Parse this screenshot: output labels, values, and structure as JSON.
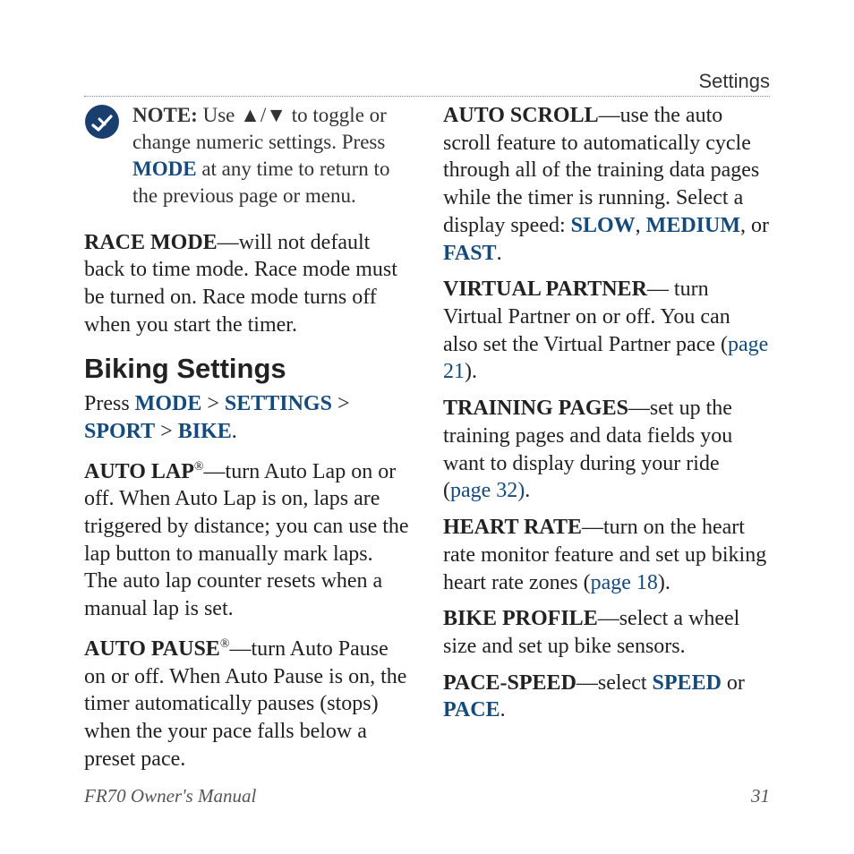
{
  "header": {
    "section_label": "Settings"
  },
  "note": {
    "prefix": "NOTE:",
    "part1": " Use ▲/▼ to toggle or change numeric settings. Press ",
    "mode": "MODE",
    "part2": " at any time to return to the previous page or menu."
  },
  "race_mode": {
    "label": "RACE MODE",
    "text": "—will not default back to time mode. Race mode must be turned on. Race mode turns off when you start the timer."
  },
  "biking": {
    "title": "Biking Settings",
    "press": "Press ",
    "mode": "MODE",
    "sep1": " > ",
    "settings": "SETTINGS",
    "sep2": " > ",
    "sport": "SPORT",
    "sep3": " > ",
    "bike": "BIKE",
    "end": "."
  },
  "auto_lap": {
    "label": "AUTO LAP",
    "reg": "®",
    "text": "—turn Auto Lap on or off. When Auto Lap is on, laps are triggered by distance; you can use the lap button to manually mark laps. The auto lap counter resets when a manual lap is set."
  },
  "auto_pause": {
    "label": "AUTO PAUSE",
    "reg": "®",
    "text": "—turn Auto Pause on or off. When Auto Pause is on, the timer automatically pauses (stops) when the your pace falls below a preset pace."
  },
  "auto_scroll": {
    "label": "AUTO SCROLL",
    "text1": "—use the auto scroll feature to automatically cycle through all of the training data pages while the timer is running. Select a display speed: ",
    "slow": "SLOW",
    "comma": ", ",
    "medium": "MEDIUM",
    "or": ", or ",
    "fast": "FAST",
    "end": "."
  },
  "virtual_partner": {
    "label": "VIRTUAL PARTNER",
    "text1": "— turn Virtual Partner on or off. You can also set the Virtual Partner pace (",
    "link": "page 21",
    "end": ")."
  },
  "training_pages": {
    "label": "TRAINING PAGES",
    "text1": "—set up the training pages and data fields you want to display during your ride (",
    "link": "page 32)",
    "end": "."
  },
  "heart_rate": {
    "label": "HEART RATE",
    "text1": "—turn on the heart rate monitor feature and set up biking heart rate zones (",
    "link": "page 18",
    "end": ")."
  },
  "bike_profile": {
    "label": "BIKE PROFILE",
    "text": "—select a wheel size and set up bike sensors."
  },
  "pace_speed": {
    "label": "PACE-SPEED",
    "text1": "—select ",
    "speed": "SPEED",
    "or": " or ",
    "pace": "PACE",
    "end": "."
  },
  "footer": {
    "left": "FR70 Owner's Manual",
    "right": "31"
  }
}
